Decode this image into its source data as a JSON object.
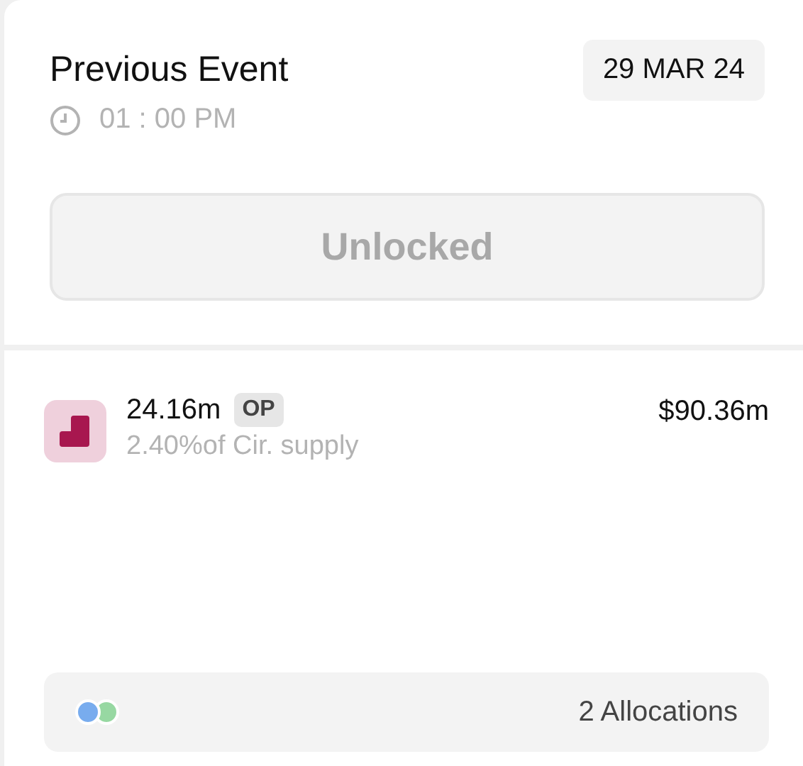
{
  "event": {
    "title": "Previous Event",
    "date": "29 MAR 24",
    "time": "01 : 00 PM",
    "button": {
      "label": "Unlocked",
      "disabled": true
    }
  },
  "token": {
    "amount": "24.16m",
    "symbol": "OP",
    "supply": "2.40%of Cir. supply",
    "value": "$90.36m"
  },
  "allocations": {
    "label": "2 Allocations",
    "dots": [
      {
        "color": "#78acee"
      },
      {
        "color": "#97d8a2"
      }
    ]
  }
}
